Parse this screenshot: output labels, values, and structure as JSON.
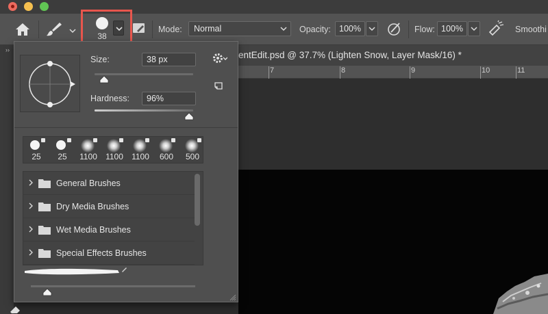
{
  "options_bar": {
    "brush_size": "38",
    "mode_label": "Mode:",
    "mode_value": "Normal",
    "opacity_label": "Opacity:",
    "opacity_value": "100%",
    "flow_label": "Flow:",
    "flow_value": "100%",
    "smoothing_label": "Smoothi"
  },
  "document": {
    "tab_title": "entEdit.psd @ 37.7% (Lighten Snow, Layer Mask/16) *",
    "ruler_ticks": [
      "7",
      "8",
      "9",
      "10",
      "11"
    ]
  },
  "brush_panel": {
    "size_label": "Size:",
    "size_value": "38 px",
    "size_fraction": 0.1,
    "hardness_label": "Hardness:",
    "hardness_value": "96%",
    "hardness_fraction": 0.96,
    "recent_brushes": [
      {
        "label": "25",
        "style": "hard"
      },
      {
        "label": "25",
        "style": "hard"
      },
      {
        "label": "1100",
        "style": "soft"
      },
      {
        "label": "1100",
        "style": "soft"
      },
      {
        "label": "1100",
        "style": "soft"
      },
      {
        "label": "600",
        "style": "soft"
      },
      {
        "label": "500",
        "style": "soft"
      }
    ],
    "folders": [
      {
        "name": "General Brushes"
      },
      {
        "name": "Dry Media Brushes"
      },
      {
        "name": "Wet Media Brushes"
      },
      {
        "name": "Special Effects Brushes"
      }
    ],
    "icons": {
      "settings": "gear-icon",
      "new_preset": "new-preset-icon",
      "folder": "folder-icon",
      "expand": "chevron-right-icon"
    }
  },
  "colors": {
    "highlight": "#e8564d",
    "panel": "#4f4f4f",
    "toolbar": "#535353"
  }
}
